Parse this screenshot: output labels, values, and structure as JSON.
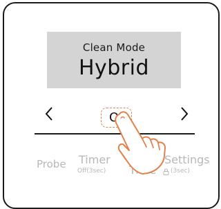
{
  "display": {
    "mode_label": "Clean Mode",
    "mode_value": "Hybrid"
  },
  "controls": {
    "prev_icon": "chevron-left-icon",
    "next_icon": "chevron-right-icon",
    "ok_label": "OK"
  },
  "functions": {
    "probe": {
      "label": "Probe"
    },
    "timer": {
      "label": "Timer",
      "sub": "Off(3sec)"
    },
    "cook_time": {
      "line1": "Co",
      "line2": "Time"
    },
    "settings": {
      "label": "Settings",
      "sub": "(3sec)",
      "icon": "lock-icon"
    }
  },
  "overlay": {
    "icon": "pointing-hand-icon"
  },
  "colors": {
    "panel_border": "#1a1a1a",
    "lcd_background": "#d4d4d4",
    "ok_highlight": "#e2814a",
    "inactive_text": "#b8b8b8"
  }
}
